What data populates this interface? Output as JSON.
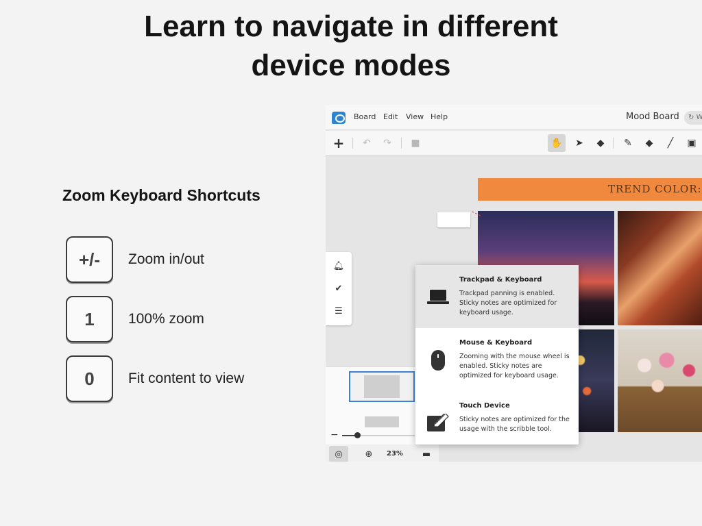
{
  "page": {
    "title_line1": "Learn to navigate in different",
    "title_line2": "device modes"
  },
  "shortcuts": {
    "heading": "Zoom Keyboard Shortcuts",
    "items": [
      {
        "key": "+/-",
        "description": "Zoom in/out"
      },
      {
        "key": "1",
        "description": "100% zoom"
      },
      {
        "key": "0",
        "description": "Fit content to view"
      }
    ]
  },
  "app": {
    "menu": [
      "Board",
      "Edit",
      "View",
      "Help"
    ],
    "board_name": "Mood Board",
    "board_chip": "W",
    "canvas": {
      "banner": "TREND COLOR: OR",
      "zoom_percent": "23%",
      "zoom_minus": "−"
    },
    "device_modes": [
      {
        "title": "Trackpad & Keyboard",
        "description": "Trackpad panning is enabled. Sticky notes are optimized for keyboard usage.",
        "selected": true,
        "icon": "laptop-icon"
      },
      {
        "title": "Mouse & Keyboard",
        "description": "Zooming with the mouse wheel is enabled. Sticky notes are optimized for keyboard usage.",
        "selected": false,
        "icon": "mouse-icon"
      },
      {
        "title": "Touch Device",
        "description": "Sticky notes are optimized for the usage with the scribble tool.",
        "selected": false,
        "icon": "pencil-edit-icon"
      }
    ]
  },
  "colors": {
    "background": "#f3f3f3",
    "banner": "#f0883e",
    "accent": "#3b82d6"
  }
}
